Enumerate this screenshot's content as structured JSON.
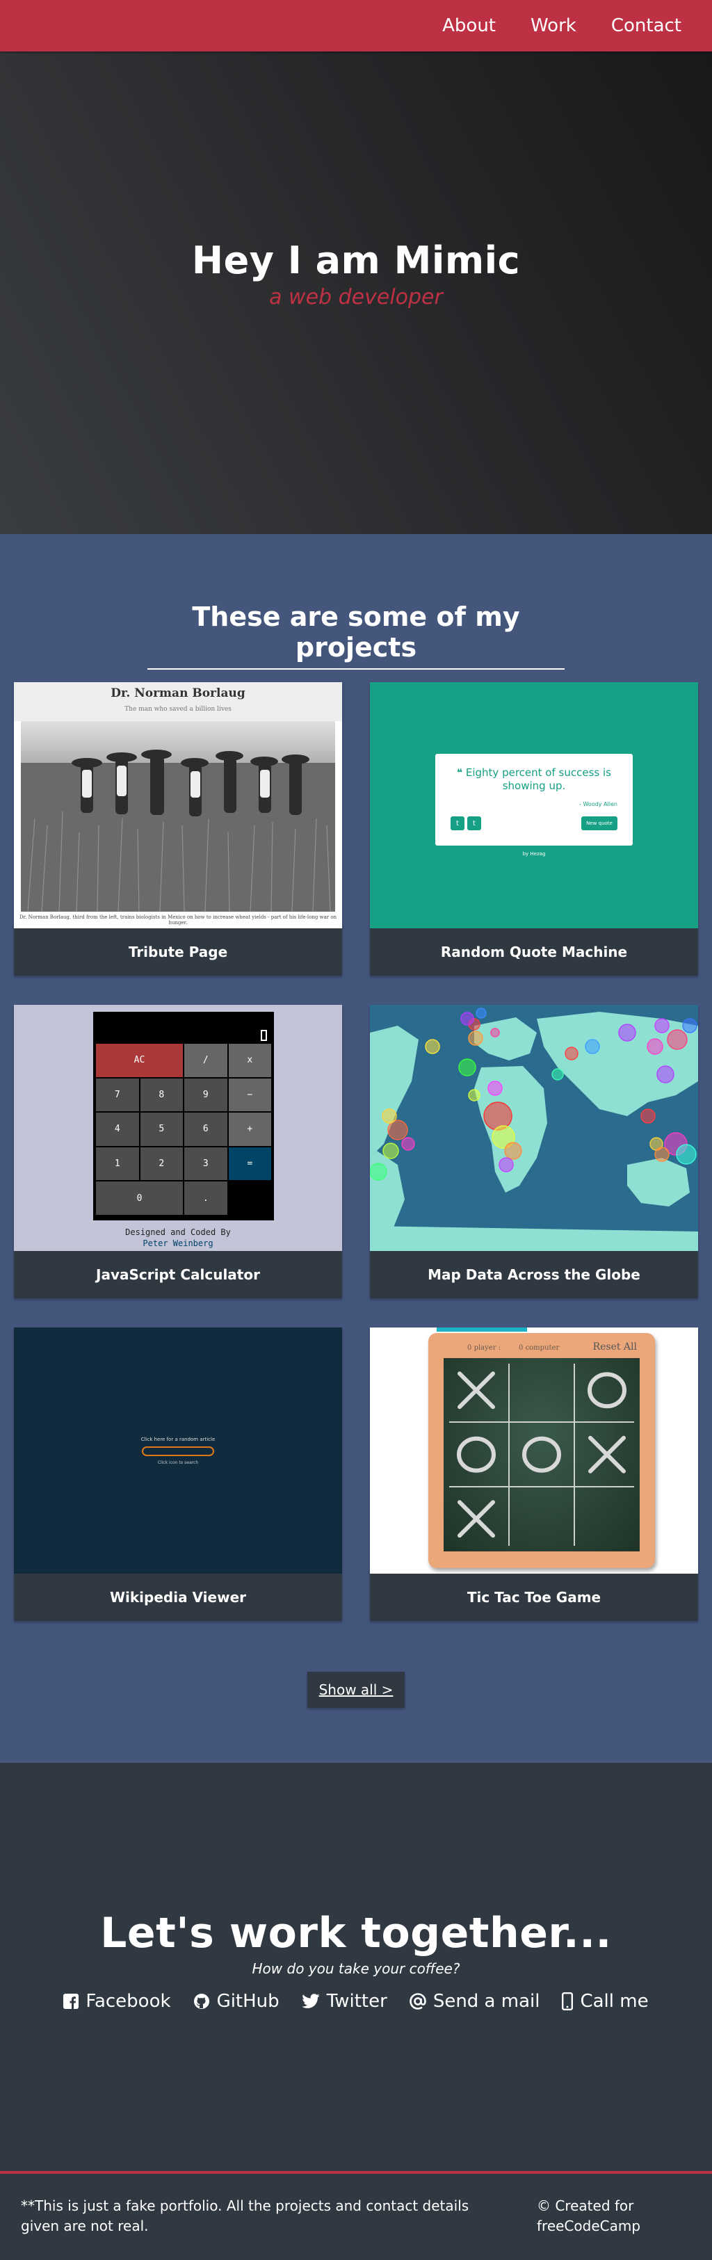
{
  "nav": {
    "items": [
      {
        "label": "About"
      },
      {
        "label": "Work"
      },
      {
        "label": "Contact"
      }
    ]
  },
  "hero": {
    "title": "Hey I am Mimic",
    "subtitle": "a web developer"
  },
  "projects": {
    "title": "These are some of my projects",
    "items": [
      {
        "label": "Tribute Page"
      },
      {
        "label": "Random Quote Machine"
      },
      {
        "label": "JavaScript Calculator"
      },
      {
        "label": "Map Data Across the Globe"
      },
      {
        "label": "Wikipedia Viewer"
      },
      {
        "label": "Tic Tac Toe Game"
      }
    ],
    "show_all": "Show all >"
  },
  "thumbs": {
    "tribute": {
      "title": "Dr. Norman Borlaug",
      "subtitle": "The man who saved a billion lives",
      "caption": "Dr. Norman Borlaug, third from the left, trains biologists in Mexico on how to increase wheat yields - part of his life-long war on hunger."
    },
    "quote": {
      "text": "Eighty percent of success is showing up.",
      "author": "- Woody Allen",
      "new_quote": "New quote",
      "by": "by Hezag"
    },
    "calc": {
      "keys": [
        "AC",
        "/",
        "x",
        "7",
        "8",
        "9",
        "−",
        "4",
        "5",
        "6",
        "+",
        "1",
        "2",
        "3",
        "=",
        "0",
        "."
      ],
      "designed": "Designed and Coded By",
      "author": "Peter Weinberg"
    },
    "wiki": {
      "random": "Click here for a random article",
      "hint": "Click icon to search"
    },
    "ttt": {
      "player": "player :",
      "computer": "computer",
      "player_score": "0",
      "computer_score": "0",
      "reset": "Reset All",
      "board": [
        "X",
        "",
        "O",
        "O",
        "O",
        "X",
        "X",
        "",
        ""
      ]
    }
  },
  "contact": {
    "title": "Let's work together...",
    "subtitle": "How do you take your coffee?",
    "links": [
      {
        "label": "Facebook",
        "icon": "facebook-icon"
      },
      {
        "label": "GitHub",
        "icon": "github-icon"
      },
      {
        "label": "Twitter",
        "icon": "twitter-icon"
      },
      {
        "label": "Send a mail",
        "icon": "at-icon"
      },
      {
        "label": "Call me",
        "icon": "mobile-phone-icon"
      }
    ]
  },
  "footer": {
    "disclaimer": "**This is just a fake portfolio. All the projects and contact details given are not real.",
    "credit": "© Created for freeCodeCamp"
  },
  "colors": {
    "accent": "#be3144",
    "projects_bg": "#45567d",
    "dark": "#303841"
  }
}
